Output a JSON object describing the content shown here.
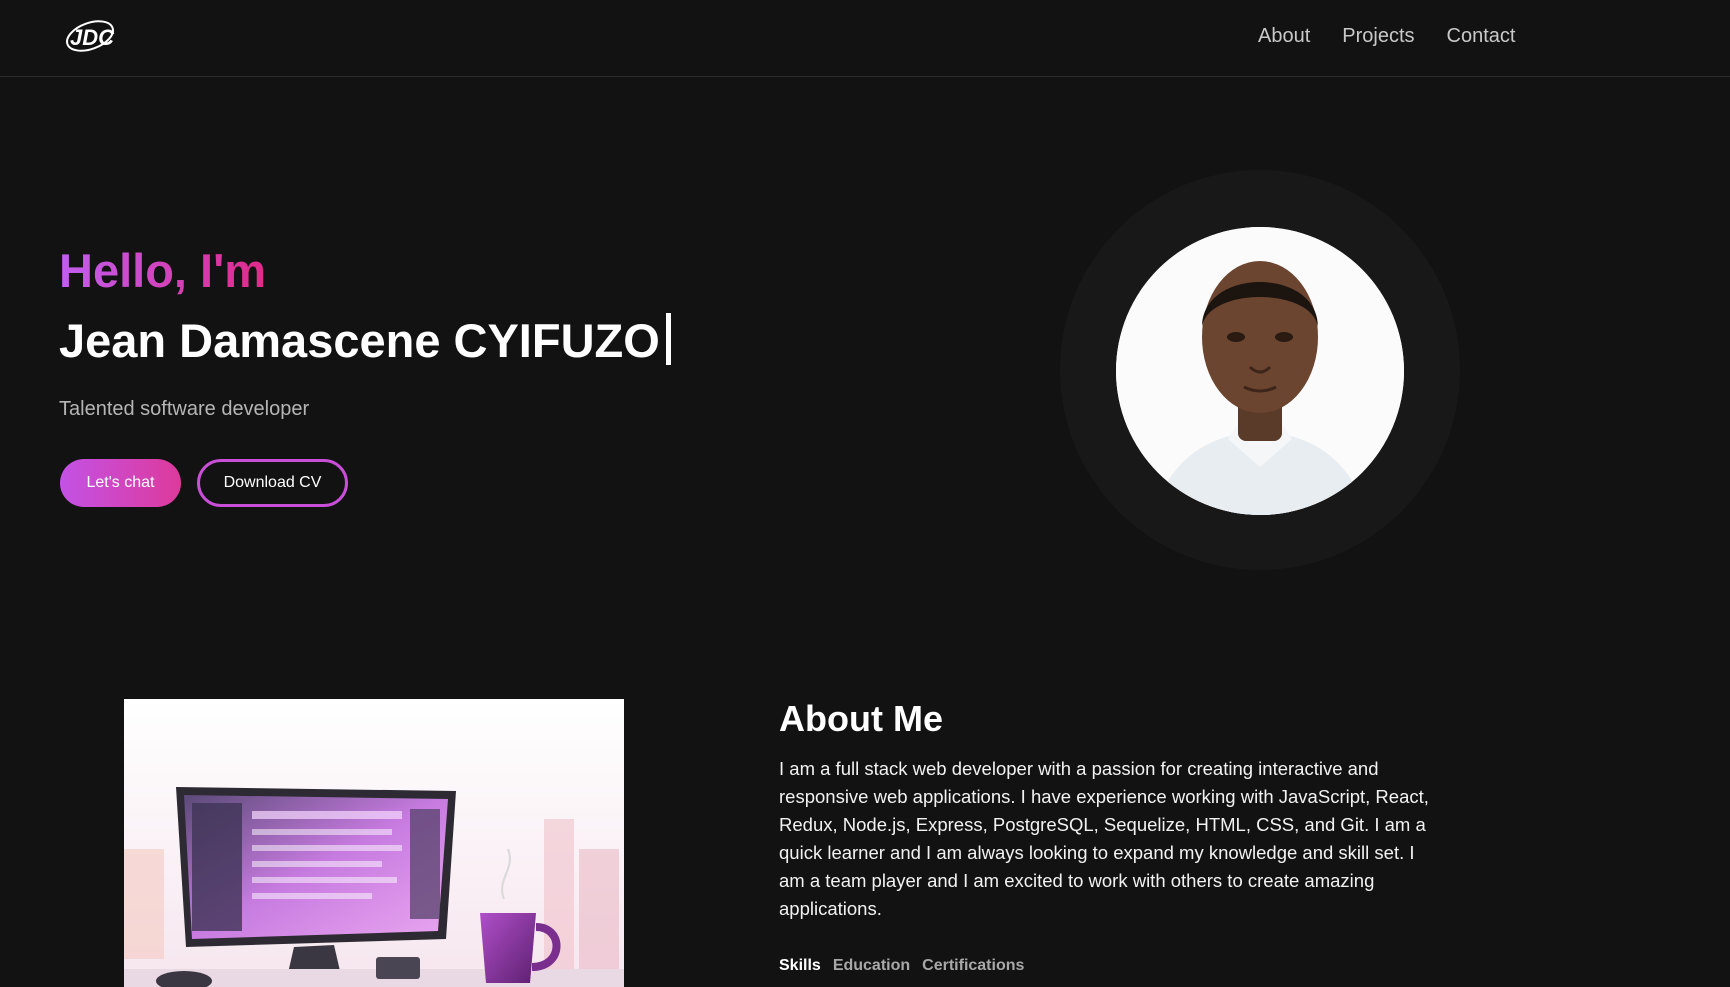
{
  "header": {
    "logo_text": "JDC",
    "nav": [
      "About",
      "Projects",
      "Contact"
    ]
  },
  "hero": {
    "greeting": "Hello, I'm",
    "name": "Jean Damascene CYIFUZO",
    "tagline": "Talented software developer",
    "primary_button": "Let's chat",
    "secondary_button": "Download CV"
  },
  "about": {
    "title": "About Me",
    "body": "I am a full stack web developer with a passion for creating interactive and responsive web applications. I have experience working with JavaScript, React, Redux, Node.js, Express, PostgreSQL, Sequelize, HTML, CSS, and Git. I am a quick learner and I am always looking to expand my knowledge and skill set. I am a team player and I am excited to work with others to create amazing applications.",
    "tabs": [
      "Skills",
      "Education",
      "Certifications"
    ],
    "active_tab": "Skills"
  },
  "colors": {
    "background": "#121212",
    "accent_start": "#c15ef0",
    "accent_end": "#e02a8a"
  }
}
